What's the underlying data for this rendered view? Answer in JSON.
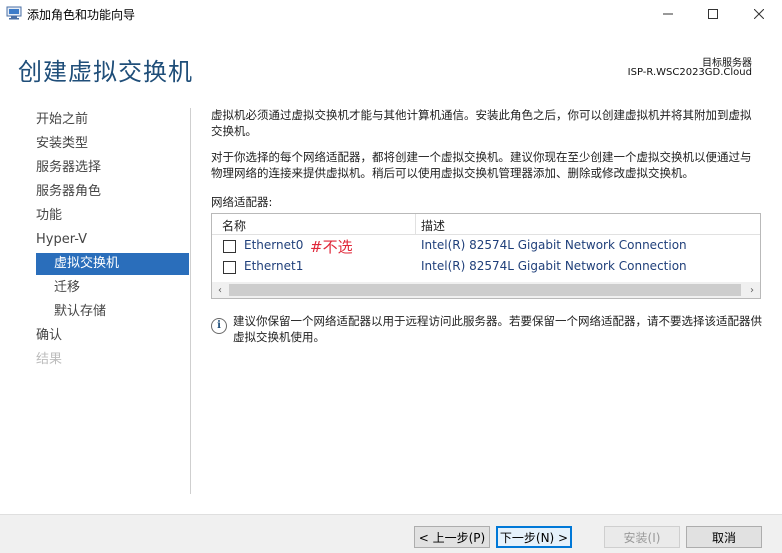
{
  "window": {
    "title": "添加角色和功能向导",
    "controls": {
      "minimize": "—",
      "maximize": "☐",
      "close": "✕"
    }
  },
  "header": {
    "page_title": "创建虚拟交换机",
    "target_label": "目标服务器",
    "target_value": "ISP-R.WSC2023GD.Cloud"
  },
  "sidebar": {
    "items": [
      {
        "label": "开始之前",
        "state": "normal"
      },
      {
        "label": "安装类型",
        "state": "normal"
      },
      {
        "label": "服务器选择",
        "state": "normal"
      },
      {
        "label": "服务器角色",
        "state": "normal"
      },
      {
        "label": "功能",
        "state": "normal"
      },
      {
        "label": "Hyper-V",
        "state": "normal"
      },
      {
        "label": "虚拟交换机",
        "state": "selected"
      },
      {
        "label": "迁移",
        "state": "sub"
      },
      {
        "label": "默认存储",
        "state": "sub"
      },
      {
        "label": "确认",
        "state": "normal"
      },
      {
        "label": "结果",
        "state": "disabled"
      }
    ]
  },
  "main": {
    "intro_1": "虚拟机必须通过虚拟交换机才能与其他计算机通信。安装此角色之后，你可以创建虚拟机并将其附加到虚拟交换机。",
    "intro_2": "对于你选择的每个网络适配器，都将创建一个虚拟交换机。建议你现在至少创建一个虚拟交换机以便通过与物理网络的连接来提供虚拟机。稍后可以使用虚拟交换机管理器添加、删除或修改虚拟交换机。",
    "adapters_label": "网络适配器:",
    "columns": {
      "name": "名称",
      "description": "描述"
    },
    "adapters": [
      {
        "name": "Ethernet0",
        "description": "Intel(R) 82574L Gigabit Network Connection",
        "checked": false,
        "annotation": "#不选"
      },
      {
        "name": "Ethernet1",
        "description": "Intel(R) 82574L Gigabit Network Connection",
        "checked": false,
        "annotation": ""
      }
    ],
    "scroll_left": "‹",
    "scroll_right": "›",
    "info_icon": "i",
    "info_text": "建议你保留一个网络适配器以用于远程访问此服务器。若要保留一个网络适配器，请不要选择该适配器供虚拟交换机使用。"
  },
  "footer": {
    "back": "< 上一步(P)",
    "next": "下一步(N) >",
    "install": "安装(I)",
    "cancel": "取消"
  },
  "colors": {
    "accent": "#2a6ebb",
    "title": "#1f4e79",
    "annotation": "#e0283a"
  }
}
